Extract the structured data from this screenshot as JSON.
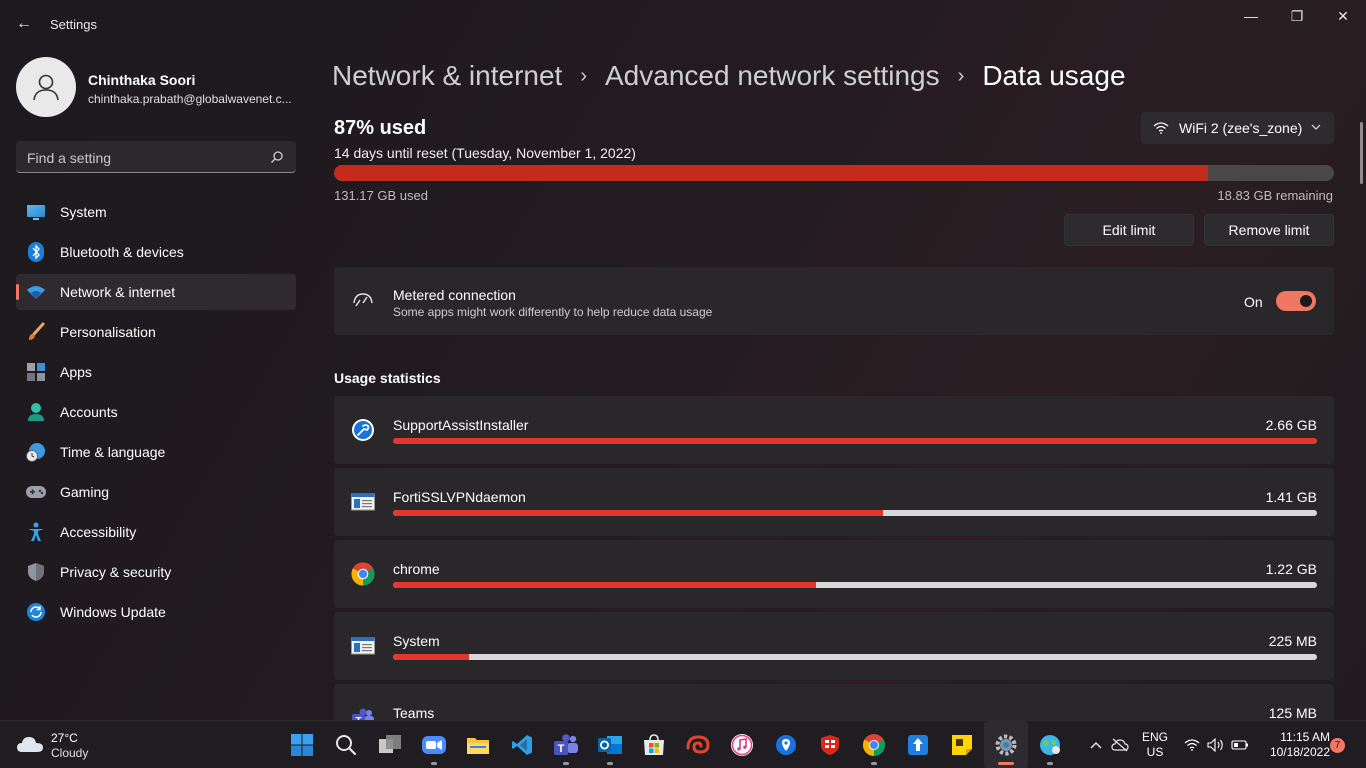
{
  "window": {
    "title": "Settings",
    "back_glyph": "←",
    "minimize_glyph": "—",
    "maximize_glyph": "❐",
    "close_glyph": "✕"
  },
  "profile": {
    "name": "Chinthaka Soori",
    "email": "chinthaka.prabath@globalwavenet.c..."
  },
  "search": {
    "placeholder": "Find a setting"
  },
  "sidebar": {
    "items": [
      {
        "label": "System",
        "icon": "monitor-icon",
        "active": false
      },
      {
        "label": "Bluetooth & devices",
        "icon": "bluetooth-icon",
        "active": false
      },
      {
        "label": "Network & internet",
        "icon": "wifi-icon",
        "active": true
      },
      {
        "label": "Personalisation",
        "icon": "brush-icon",
        "active": false
      },
      {
        "label": "Apps",
        "icon": "apps-icon",
        "active": false
      },
      {
        "label": "Accounts",
        "icon": "person-icon",
        "active": false
      },
      {
        "label": "Time & language",
        "icon": "globe-clock-icon",
        "active": false
      },
      {
        "label": "Gaming",
        "icon": "gamepad-icon",
        "active": false
      },
      {
        "label": "Accessibility",
        "icon": "accessibility-icon",
        "active": false
      },
      {
        "label": "Privacy & security",
        "icon": "shield-icon",
        "active": false
      },
      {
        "label": "Windows Update",
        "icon": "update-icon",
        "active": false
      }
    ]
  },
  "breadcrumb": {
    "items": [
      "Network & internet",
      "Advanced network settings"
    ],
    "current": "Data usage",
    "separator": "›"
  },
  "data_usage": {
    "used_title": "87% used",
    "reset_text": "14 days until reset (Tuesday, November 1, 2022)",
    "used_fraction": 0.874,
    "used_amount": "131.17 GB used",
    "remaining_amount": "18.83 GB remaining",
    "network_selector": "WiFi 2 (zee's_zone)",
    "edit_limit_label": "Edit limit",
    "remove_limit_label": "Remove limit"
  },
  "metered": {
    "title": "Metered connection",
    "subtitle": "Some apps might work differently to help reduce data usage",
    "state_label": "On",
    "enabled": true
  },
  "usage_statistics": {
    "title": "Usage statistics",
    "apps": [
      {
        "name": "SupportAssistInstaller",
        "amount": "2.66 GB",
        "fraction": 1.0,
        "icon": "supportassist-icon"
      },
      {
        "name": "FortiSSLVPNdaemon",
        "amount": "1.41 GB",
        "fraction": 0.53,
        "icon": "window-app-icon"
      },
      {
        "name": "chrome",
        "amount": "1.22 GB",
        "fraction": 0.458,
        "icon": "chrome-icon"
      },
      {
        "name": "System",
        "amount": "225 MB",
        "fraction": 0.082,
        "icon": "window-app-icon"
      },
      {
        "name": "Teams",
        "amount": "125 MB",
        "fraction": 0.046,
        "icon": "teams-icon"
      }
    ]
  },
  "colors": {
    "accent": "#f07863",
    "data_bar_fill": "#c42b1c",
    "usage_bar_fill": "#e0382c"
  },
  "taskbar": {
    "weather_temp": "27°C",
    "weather_desc": "Cloudy",
    "lang_line1": "ENG",
    "lang_line2": "US",
    "time": "11:15 AM",
    "date": "10/18/2022",
    "notification_count": "7",
    "apps": [
      "start-icon",
      "search-icon",
      "task-view-icon",
      "zoom-icon",
      "file-explorer-icon",
      "vscode-icon",
      "teams-icon",
      "outlook-icon",
      "store-icon",
      "app-swirl-icon",
      "itunes-icon",
      "maps-pin-icon",
      "fortinet-icon",
      "chrome-icon",
      "upload-app-icon",
      "sticky-notes-icon",
      "settings-icon",
      "network-globe-icon"
    ]
  }
}
